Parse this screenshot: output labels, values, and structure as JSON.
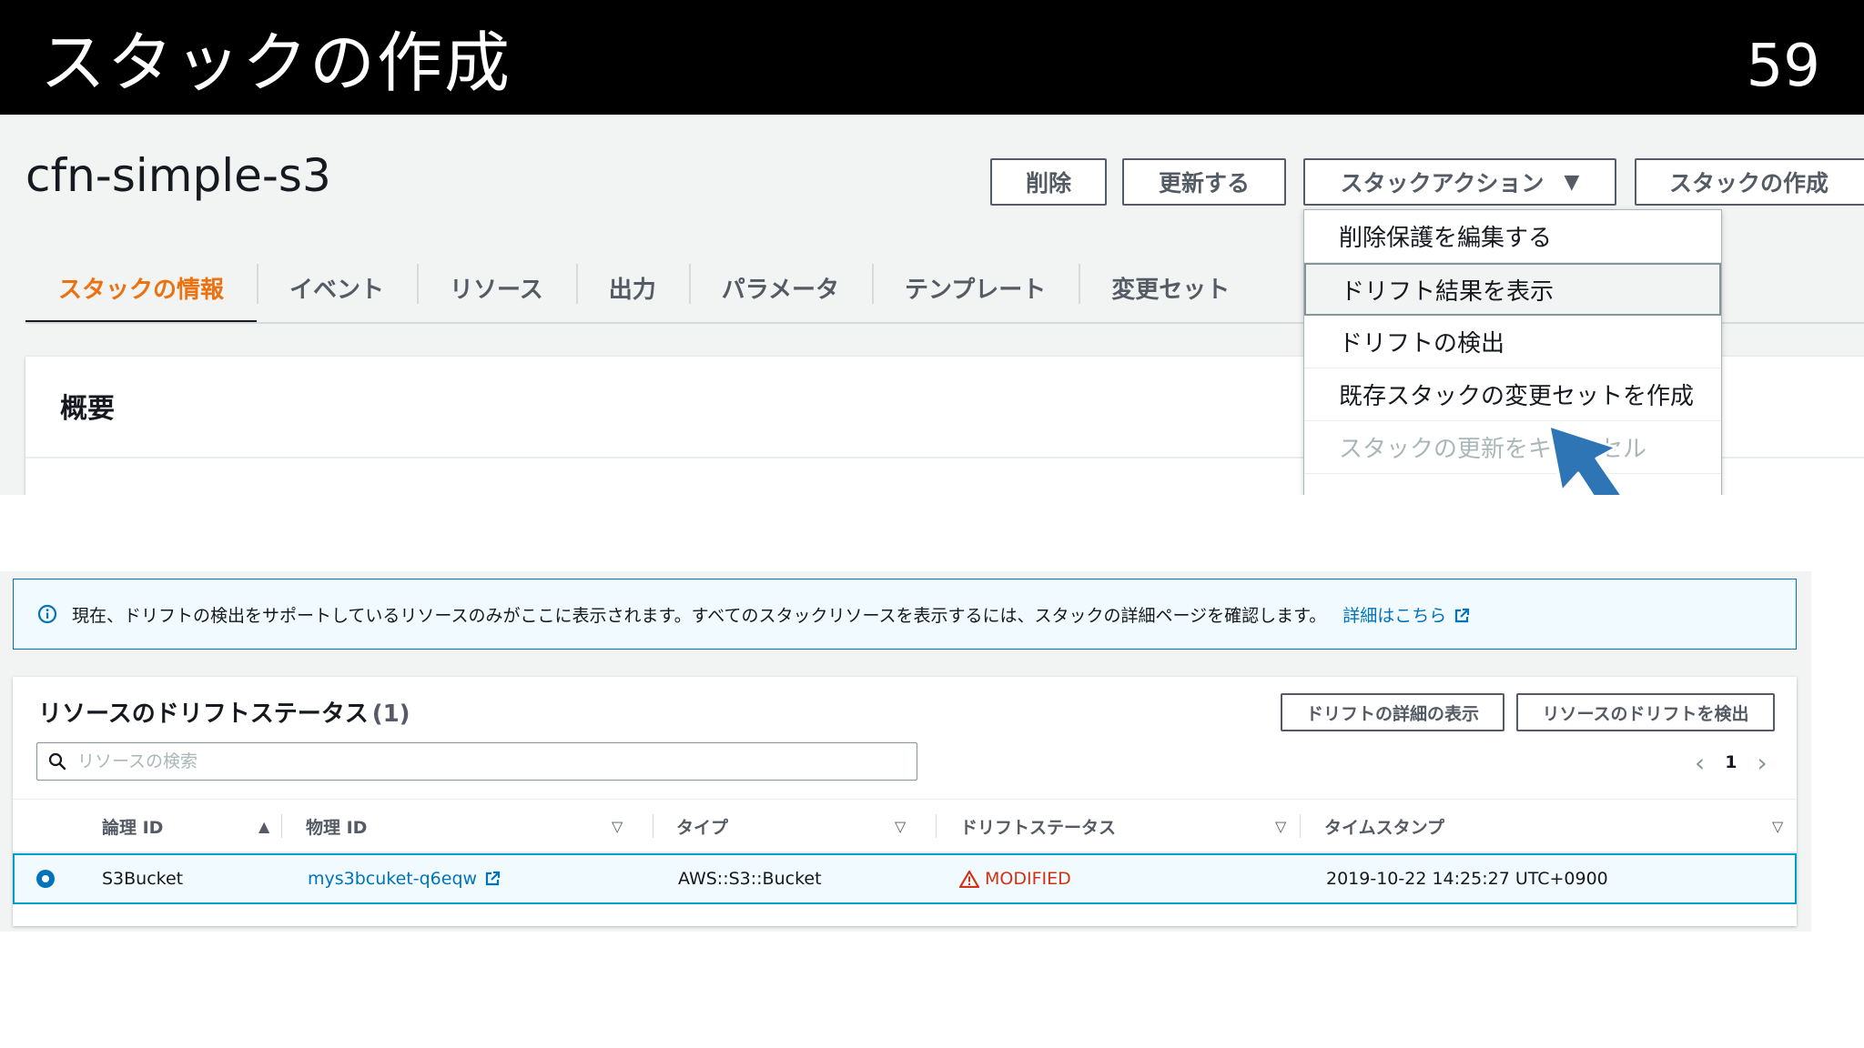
{
  "slide": {
    "title": "スタックの作成",
    "page_number": "59"
  },
  "stack_page": {
    "stack_name": "cfn-simple-s3",
    "buttons": {
      "delete": "削除",
      "update": "更新する",
      "stack_actions": "スタックアクション",
      "create_stack": "スタックの作成"
    },
    "tabs": [
      "スタックの情報",
      "イベント",
      "リソース",
      "出力",
      "パラメータ",
      "テンプレート",
      "変更セット"
    ],
    "active_tab": "スタックの情報",
    "overview_title": "概要",
    "stack_actions_menu": [
      {
        "label": "削除保護を編集する",
        "state": "normal"
      },
      {
        "label": "ドリフト結果を表示",
        "state": "highlighted"
      },
      {
        "label": "ドリフトの検出",
        "state": "normal"
      },
      {
        "label": "既存スタックの変更セットを作成",
        "state": "normal"
      },
      {
        "label": "スタックの更新をキャンセル",
        "state": "disabled"
      }
    ]
  },
  "drift_page": {
    "info_banner": {
      "text": "現在、ドリフトの検出をサポートしているリソースのみがここに表示されます。すべてのスタックリソースを表示するには、スタックの詳細ページを確認します。",
      "link": "詳細はこちら"
    },
    "card_title": "リソースのドリフトステータス",
    "count": "(1)",
    "buttons": {
      "view_drift_details": "ドリフトの詳細の表示",
      "detect_resource_drift": "リソースのドリフトを検出"
    },
    "search_placeholder": "リソースの検索",
    "pagination": {
      "current_page": "1"
    },
    "columns": [
      "論理 ID",
      "物理 ID",
      "タイプ",
      "ドリフトステータス",
      "タイムスタンプ"
    ],
    "rows": [
      {
        "logical_id": "S3Bucket",
        "physical_id": "mys3bcuket-q6eqw",
        "type": "AWS::S3::Bucket",
        "drift_status": "MODIFIED",
        "timestamp": "2019-10-22 14:25:27 UTC+0900",
        "selected": true
      }
    ]
  },
  "colors": {
    "accent_orange": "#ec7211",
    "link_blue": "#0073bb",
    "modified_red": "#d13212",
    "pointer_arrow": "#2e75b6"
  }
}
